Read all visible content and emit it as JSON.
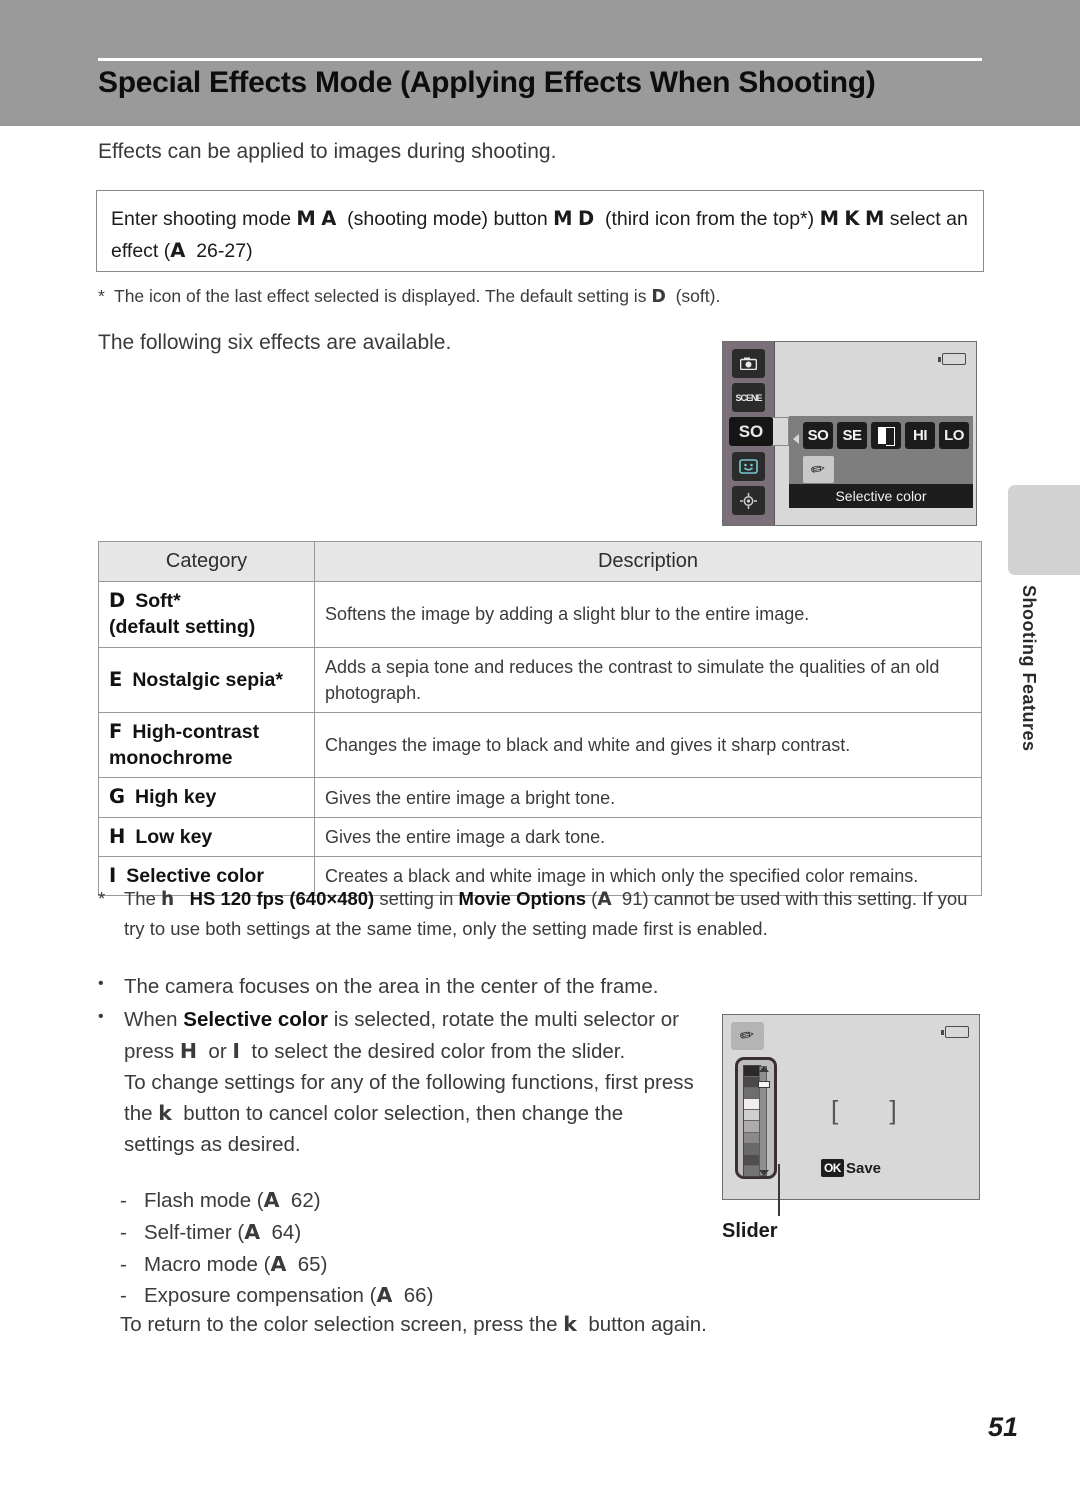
{
  "header": {
    "title": "Special Effects Mode (Applying Effects When Shooting)"
  },
  "intro": "Effects can be applied to images during shooting.",
  "step_box": {
    "line1_a": "Enter shooting mode",
    "sym_m1": "M",
    "sym_a": "A",
    "line1_b": "(shooting mode) button",
    "sym_m2": "M",
    "sym_d": "D",
    "line1_c": "(third icon from the top*)",
    "sym_m3": "M",
    "sym_k": "K",
    "sym_m4": "M",
    "line2": "select an effect (",
    "sym_a2": "A",
    "page_ref": "26-27",
    "line2_end": ")"
  },
  "note_star": {
    "mark": "*",
    "text_a": "The icon of the last effect selected is displayed. The default setting is",
    "sym_d": "D",
    "text_b": "(soft)."
  },
  "six_effects_line": "The following six effects are available.",
  "camera_screen_1": {
    "sidebar_icons": [
      "camera-icon",
      "scene-icon",
      "so-icon",
      "smile-icon",
      "target-icon"
    ],
    "selected_sidebar": "SO",
    "scene_label": "SCENE",
    "effect_icons": [
      "SO",
      "SE",
      "half-square",
      "HI",
      "LO"
    ],
    "selected_effect": "eyedropper-icon",
    "menu_label": "Selective color",
    "battery": "battery-icon"
  },
  "table": {
    "headers": [
      "Category",
      "Description"
    ],
    "rows": [
      {
        "sym": "D",
        "label": "Soft*",
        "sublabel": "(default setting)",
        "desc": "Softens the image by adding a slight blur to the entire image."
      },
      {
        "sym": "E",
        "label": "Nostalgic sepia*",
        "sublabel": "",
        "desc": "Adds a sepia tone and reduces the contrast to simulate the qualities of an old photograph."
      },
      {
        "sym": "F",
        "label": "High-contrast",
        "sublabel": "monochrome",
        "desc": "Changes the image to black and white and gives it sharp contrast."
      },
      {
        "sym": "G",
        "label": "High key",
        "sublabel": "",
        "desc": "Gives the entire image a bright tone."
      },
      {
        "sym": "H",
        "label": "Low key",
        "sublabel": "",
        "desc": "Gives the entire image a dark tone."
      },
      {
        "sym": "I",
        "label": "Selective color",
        "sublabel": "",
        "desc": "Creates a black and white image in which only the specified color remains."
      }
    ]
  },
  "note_hs": {
    "mark": "*",
    "p1": "The",
    "sym_h": "h",
    "bold1": "HS 120 fps (640×480)",
    "p2": "setting in",
    "bold2": "Movie Options",
    "p3": "(",
    "sym_a": "A",
    "page_ref": "91",
    "p4": ") cannot be used with this setting. If you try to use both settings at the same time, only the setting made first is enabled."
  },
  "bullets": [
    {
      "dot": "•",
      "text": "The camera focuses on the area in the center of the frame."
    },
    {
      "dot": "•",
      "t1": "When",
      "bold": "Selective color",
      "t2": "is selected, rotate the multi selector or press",
      "sym_h": "H",
      "t3": "or",
      "sym_i": "I",
      "t4": "to select the desired color from the slider.",
      "t5": "To change settings for any of the following functions, first press the",
      "sym_k": "k",
      "t6": "button to cancel color selection, then change the settings as desired."
    }
  ],
  "dash_items": [
    {
      "dash": "-",
      "label": "Flash mode (",
      "sym": "A",
      "page": "62",
      "close": ")"
    },
    {
      "dash": "-",
      "label": "Self-timer (",
      "sym": "A",
      "page": "64",
      "close": ")"
    },
    {
      "dash": "-",
      "label": "Macro mode (",
      "sym": "A",
      "page": "65",
      "close": ")"
    },
    {
      "dash": "-",
      "label": "Exposure compensation (",
      "sym": "A",
      "page": "66",
      "close": ")"
    }
  ],
  "closing": {
    "t1": "To return to the color selection screen, press the",
    "sym_k": "k",
    "t2": "button again."
  },
  "camera_screen_2": {
    "dropper_icon": "eyedropper-icon",
    "battery": "battery-icon",
    "focus_brackets": "[   ]",
    "ok_badge": "OK",
    "save_label": "Save",
    "leader_label": "Slider"
  },
  "side_tab": {
    "text": "Shooting Features"
  },
  "page_number": "51",
  "colors": {
    "header_band": "#9a9a9a",
    "table_header_bg": "#e6e6e6",
    "rule": "#9a9a9a",
    "side_tab": "#d2d2d2",
    "screen_bg": "#d8d8d8"
  }
}
